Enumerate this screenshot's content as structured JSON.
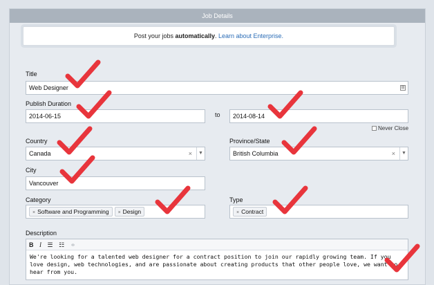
{
  "header": {
    "title": "Job Details"
  },
  "promo": {
    "text_before": "Post your jobs ",
    "bold": "automatically",
    "text_after": ". ",
    "link": "Learn about Enterprise."
  },
  "form": {
    "title_label": "Title",
    "title_value": "Web Designer",
    "publish_label": "Publish Duration",
    "start_date": "2014-06-15",
    "to_label": "to",
    "end_date": "2014-08-14",
    "never_close_label": "Never Close",
    "country_label": "Country",
    "country_value": "Canada",
    "province_label": "Province/State",
    "province_value": "British Columbia",
    "city_label": "City",
    "city_value": "Vancouver",
    "category_label": "Category",
    "category_tags": [
      "Software and Programming",
      "Design"
    ],
    "type_label": "Type",
    "type_tags": [
      "Contract"
    ],
    "description_label": "Description",
    "description_text": "We're looking for a talented web designer for a contract position to join our rapidly growing team. If you love design, web technologies, and are passionate about creating products that other people love, we want to hear from you."
  },
  "editor_toolbar": {
    "bold": "B",
    "italic": "I"
  },
  "colors": {
    "checkmark": "#e8353c",
    "link": "#2a6cb6",
    "header": "#aab3bd"
  }
}
